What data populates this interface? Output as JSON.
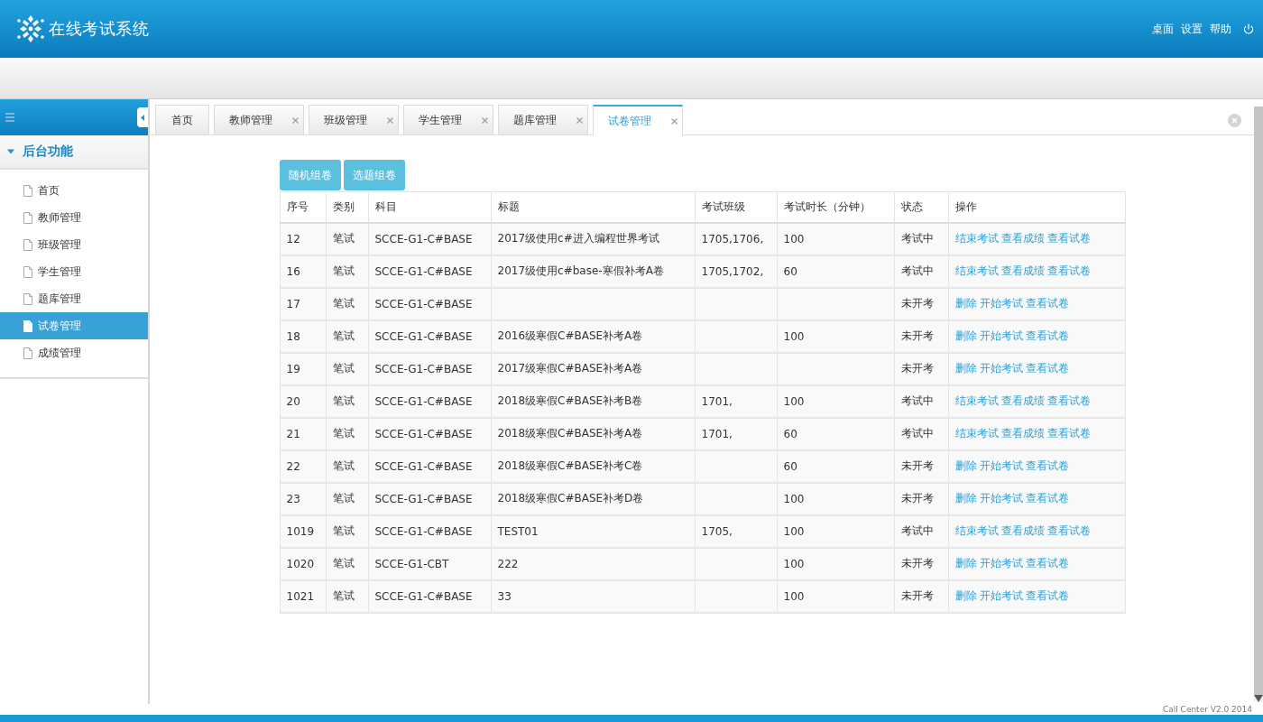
{
  "header": {
    "title": "在线考试系统",
    "links": [
      "桌面",
      "设置",
      "帮助"
    ]
  },
  "sidebar": {
    "section": {
      "title": "后台功能",
      "expanded": true
    },
    "items": [
      {
        "label": "首页",
        "selected": false
      },
      {
        "label": "教师管理",
        "selected": false
      },
      {
        "label": "班级管理",
        "selected": false
      },
      {
        "label": "学生管理",
        "selected": false
      },
      {
        "label": "题库管理",
        "selected": false
      },
      {
        "label": "试卷管理",
        "selected": true
      },
      {
        "label": "成绩管理",
        "selected": false
      }
    ]
  },
  "tabs": [
    {
      "label": "首页",
      "selected": false,
      "closable": false
    },
    {
      "label": "教师管理",
      "selected": false,
      "closable": true
    },
    {
      "label": "班级管理",
      "selected": false,
      "closable": true
    },
    {
      "label": "学生管理",
      "selected": false,
      "closable": true
    },
    {
      "label": "题库管理",
      "selected": false,
      "closable": true
    },
    {
      "label": "试卷管理",
      "selected": true,
      "closable": true
    }
  ],
  "buttons": [
    "随机组卷",
    "选题组卷"
  ],
  "table": {
    "columns": [
      "序号",
      "类别",
      "科目",
      "标题",
      "考试班级",
      "考试时长（分钟）",
      "状态",
      "操作"
    ],
    "rows": [
      {
        "no": "12",
        "category": "笔试",
        "subject": "SCCE-G1-C#BASE",
        "title": "2017级使用c#进入编程世界考试",
        "exam_class": "1705,1706,",
        "duration": "100",
        "status": "考试中",
        "actions": [
          "结束考试",
          "查看成绩",
          "查看试卷"
        ]
      },
      {
        "no": "16",
        "category": "笔试",
        "subject": "SCCE-G1-C#BASE",
        "title": "2017级使用c#base-寒假补考A卷",
        "exam_class": "1705,1702,",
        "duration": "60",
        "status": "考试中",
        "actions": [
          "结束考试",
          "查看成绩",
          "查看试卷"
        ]
      },
      {
        "no": "17",
        "category": "笔试",
        "subject": "SCCE-G1-C#BASE",
        "status": "未开考",
        "actions": [
          "删除",
          "开始考试",
          "查看试卷"
        ]
      },
      {
        "no": "18",
        "category": "笔试",
        "subject": "SCCE-G1-C#BASE",
        "title": "2016级寒假C#BASE补考A卷",
        "duration": "100",
        "status": "未开考",
        "actions": [
          "删除",
          "开始考试",
          "查看试卷"
        ]
      },
      {
        "no": "19",
        "category": "笔试",
        "subject": "SCCE-G1-C#BASE",
        "title": "2017级寒假C#BASE补考A卷",
        "status": "未开考",
        "actions": [
          "删除",
          "开始考试",
          "查看试卷"
        ]
      },
      {
        "no": "20",
        "category": "笔试",
        "subject": "SCCE-G1-C#BASE",
        "title": "2018级寒假C#BASE补考B卷",
        "exam_class": "1701,",
        "duration": "100",
        "status": "考试中",
        "actions": [
          "结束考试",
          "查看成绩",
          "查看试卷"
        ]
      },
      {
        "no": "21",
        "category": "笔试",
        "subject": "SCCE-G1-C#BASE",
        "title": "2018级寒假C#BASE补考A卷",
        "exam_class": "1701,",
        "duration": "60",
        "status": "考试中",
        "actions": [
          "结束考试",
          "查看成绩",
          "查看试卷"
        ]
      },
      {
        "no": "22",
        "category": "笔试",
        "subject": "SCCE-G1-C#BASE",
        "title": "2018级寒假C#BASE补考C卷",
        "duration": "60",
        "status": "未开考",
        "actions": [
          "删除",
          "开始考试",
          "查看试卷"
        ]
      },
      {
        "no": "23",
        "category": "笔试",
        "subject": "SCCE-G1-C#BASE",
        "title": "2018级寒假C#BASE补考D卷",
        "duration": "100",
        "status": "未开考",
        "actions": [
          "删除",
          "开始考试",
          "查看试卷"
        ]
      },
      {
        "no": "1019",
        "category": "笔试",
        "subject": "SCCE-G1-C#BASE",
        "title": "TEST01",
        "exam_class": "1705,",
        "duration": "100",
        "status": "考试中",
        "actions": [
          "结束考试",
          "查看成绩",
          "查看试卷"
        ]
      },
      {
        "no": "1020",
        "category": "笔试",
        "subject": "SCCE-G1-CBT",
        "title": "222",
        "duration": "100",
        "status": "未开考",
        "actions": [
          "删除",
          "开始考试",
          "查看试卷"
        ]
      },
      {
        "no": "1021",
        "category": "笔试",
        "subject": "SCCE-G1-C#BASE",
        "title": "33",
        "duration": "100",
        "status": "未开考",
        "actions": [
          "删除",
          "开始考试",
          "查看试卷"
        ]
      }
    ]
  },
  "footer": {
    "version": "Call Center V2.0 2014"
  }
}
